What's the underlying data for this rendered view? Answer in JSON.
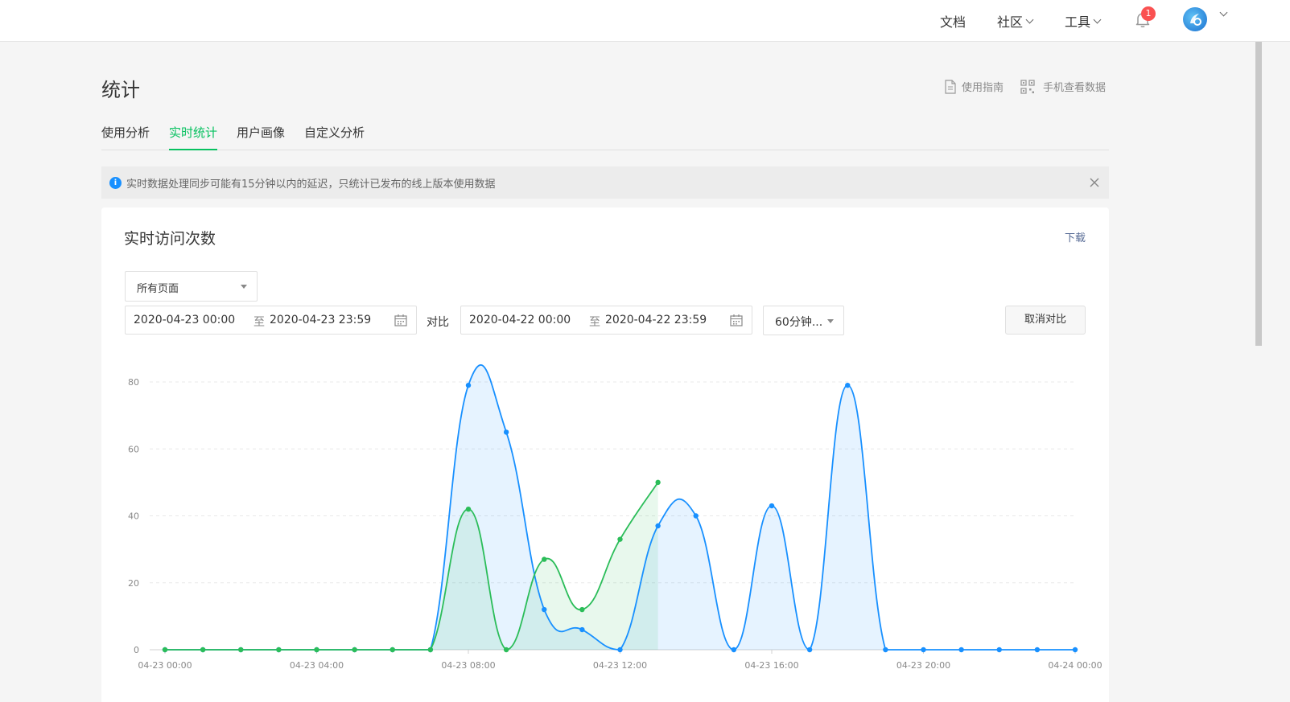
{
  "topnav": {
    "docs": "文档",
    "community": "社区",
    "tools": "工具",
    "notification_count": "1"
  },
  "header": {
    "title": "统计",
    "guide_link": "使用指南",
    "mobile_link": "手机查看数据"
  },
  "tabs": [
    {
      "label": "使用分析",
      "active": false
    },
    {
      "label": "实时统计",
      "active": true
    },
    {
      "label": "用户画像",
      "active": false
    },
    {
      "label": "自定义分析",
      "active": false
    }
  ],
  "notice": {
    "text": "实时数据处理同步可能有15分钟以内的延迟，只统计已发布的线上版本使用数据"
  },
  "card": {
    "title": "实时访问次数",
    "download": "下载",
    "page_select": "所有页面",
    "range1": {
      "start": "2020-04-23 00:00",
      "sep": "至",
      "end": "2020-04-23 23:59"
    },
    "compare_label": "对比",
    "range2": {
      "start": "2020-04-22 00:00",
      "sep": "至",
      "end": "2020-04-22 23:59"
    },
    "interval_select": "60分钟...",
    "cancel_compare": "取消对比"
  },
  "colors": {
    "accent": "#07c160",
    "series_blue": "#1890ff",
    "series_green": "#2bbd59",
    "link": "#576b95"
  },
  "chart_data": {
    "type": "area",
    "x": [
      "04-23 00:00",
      "04-23 01:00",
      "04-23 02:00",
      "04-23 03:00",
      "04-23 04:00",
      "04-23 05:00",
      "04-23 06:00",
      "04-23 07:00",
      "04-23 08:00",
      "04-23 09:00",
      "04-23 10:00",
      "04-23 11:00",
      "04-23 12:00",
      "04-23 13:00",
      "04-23 14:00",
      "04-23 15:00",
      "04-23 16:00",
      "04-23 17:00",
      "04-23 18:00",
      "04-23 19:00",
      "04-23 20:00",
      "04-23 21:00",
      "04-23 22:00",
      "04-23 23:00",
      "04-24 00:00"
    ],
    "xticks": [
      "04-23 00:00",
      "04-23 04:00",
      "04-23 08:00",
      "04-23 12:00",
      "04-23 16:00",
      "04-23 20:00",
      "04-24 00:00"
    ],
    "yticks": [
      "0",
      "20",
      "40",
      "60",
      "80"
    ],
    "ylim": [
      0,
      80
    ],
    "grid": true,
    "series": [
      {
        "color": "#1890ff",
        "values": [
          0,
          0,
          0,
          0,
          0,
          0,
          0,
          0,
          79,
          65,
          12,
          6,
          0,
          37,
          40,
          0,
          43,
          0,
          79,
          0,
          0,
          0,
          0,
          0,
          0
        ]
      },
      {
        "color": "#2bbd59",
        "values": [
          0,
          0,
          0,
          0,
          0,
          0,
          0,
          0,
          42,
          0,
          27,
          12,
          33,
          50
        ]
      }
    ]
  }
}
